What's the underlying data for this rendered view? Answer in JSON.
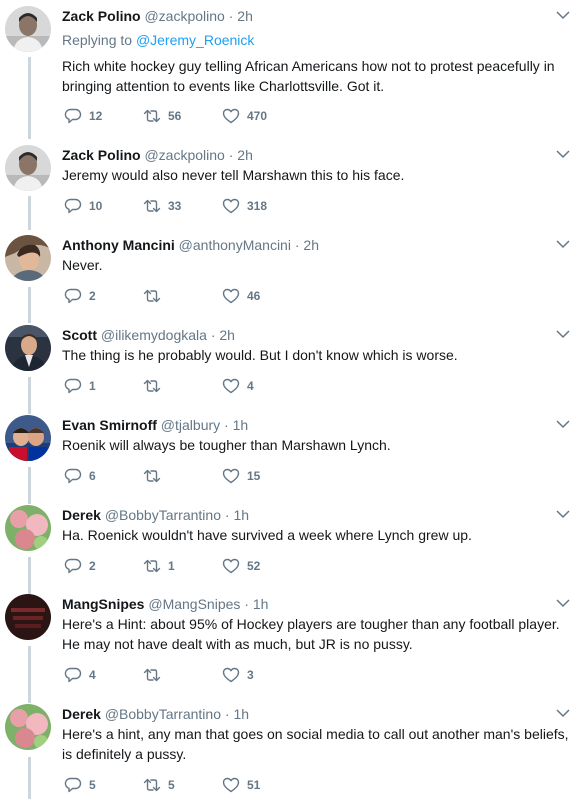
{
  "tweets": [
    {
      "name": "Zack Polino",
      "handle": "@zackpolino",
      "time": "2h",
      "reply_label": "Replying to",
      "reply_to": "@Jeremy_Roenick",
      "text": "Rich white hockey guy telling African Americans how not to protest peacefully in bringing attention to events like Charlottsville.   Got it.",
      "replies": "12",
      "retweets": "56",
      "likes": "470"
    },
    {
      "name": "Zack Polino",
      "handle": "@zackpolino",
      "time": "2h",
      "text": "Jeremy would also never tell Marshawn this to his face.",
      "replies": "10",
      "retweets": "33",
      "likes": "318"
    },
    {
      "name": "Anthony Mancini",
      "handle": "@anthonyMancini",
      "time": "2h",
      "text": "Never.",
      "replies": "2",
      "retweets": "",
      "likes": "46"
    },
    {
      "name": "Scott",
      "handle": "@ilikemydogkala",
      "time": "2h",
      "text": "The thing is he probably would. But I don't know which is worse.",
      "replies": "1",
      "retweets": "",
      "likes": "4"
    },
    {
      "name": "Evan Smirnoff",
      "handle": "@tjalbury",
      "time": "1h",
      "text": "Roenik will always be tougher than Marshawn Lynch.",
      "replies": "6",
      "retweets": "",
      "likes": "15"
    },
    {
      "name": "Derek",
      "handle": "@BobbyTarrantino",
      "time": "1h",
      "text": "Ha. Roenick wouldn't have survived a week where Lynch grew up.",
      "replies": "2",
      "retweets": "1",
      "likes": "52"
    },
    {
      "name": "MangSnipes",
      "handle": "@MangSnipes",
      "time": "1h",
      "text": "Here's a Hint: about 95% of Hockey players are tougher than any football player. He may not have dealt with as much, but JR is no pussy.",
      "replies": "4",
      "retweets": "",
      "likes": "3"
    },
    {
      "name": "Derek",
      "handle": "@BobbyTarrantino",
      "time": "1h",
      "text": "Here's a hint, any man that goes on social media to call out another man's beliefs, is definitely a pussy.",
      "replies": "5",
      "retweets": "5",
      "likes": "51"
    }
  ],
  "separator": "·",
  "icons": {
    "reply": "reply-icon",
    "retweet": "retweet-icon",
    "like": "heart-icon",
    "menu": "chevron-down-icon"
  },
  "colors": {
    "name": "#14171a",
    "muted": "#657786",
    "link": "#1da1f2",
    "thread_line": "#ccd6dd"
  }
}
